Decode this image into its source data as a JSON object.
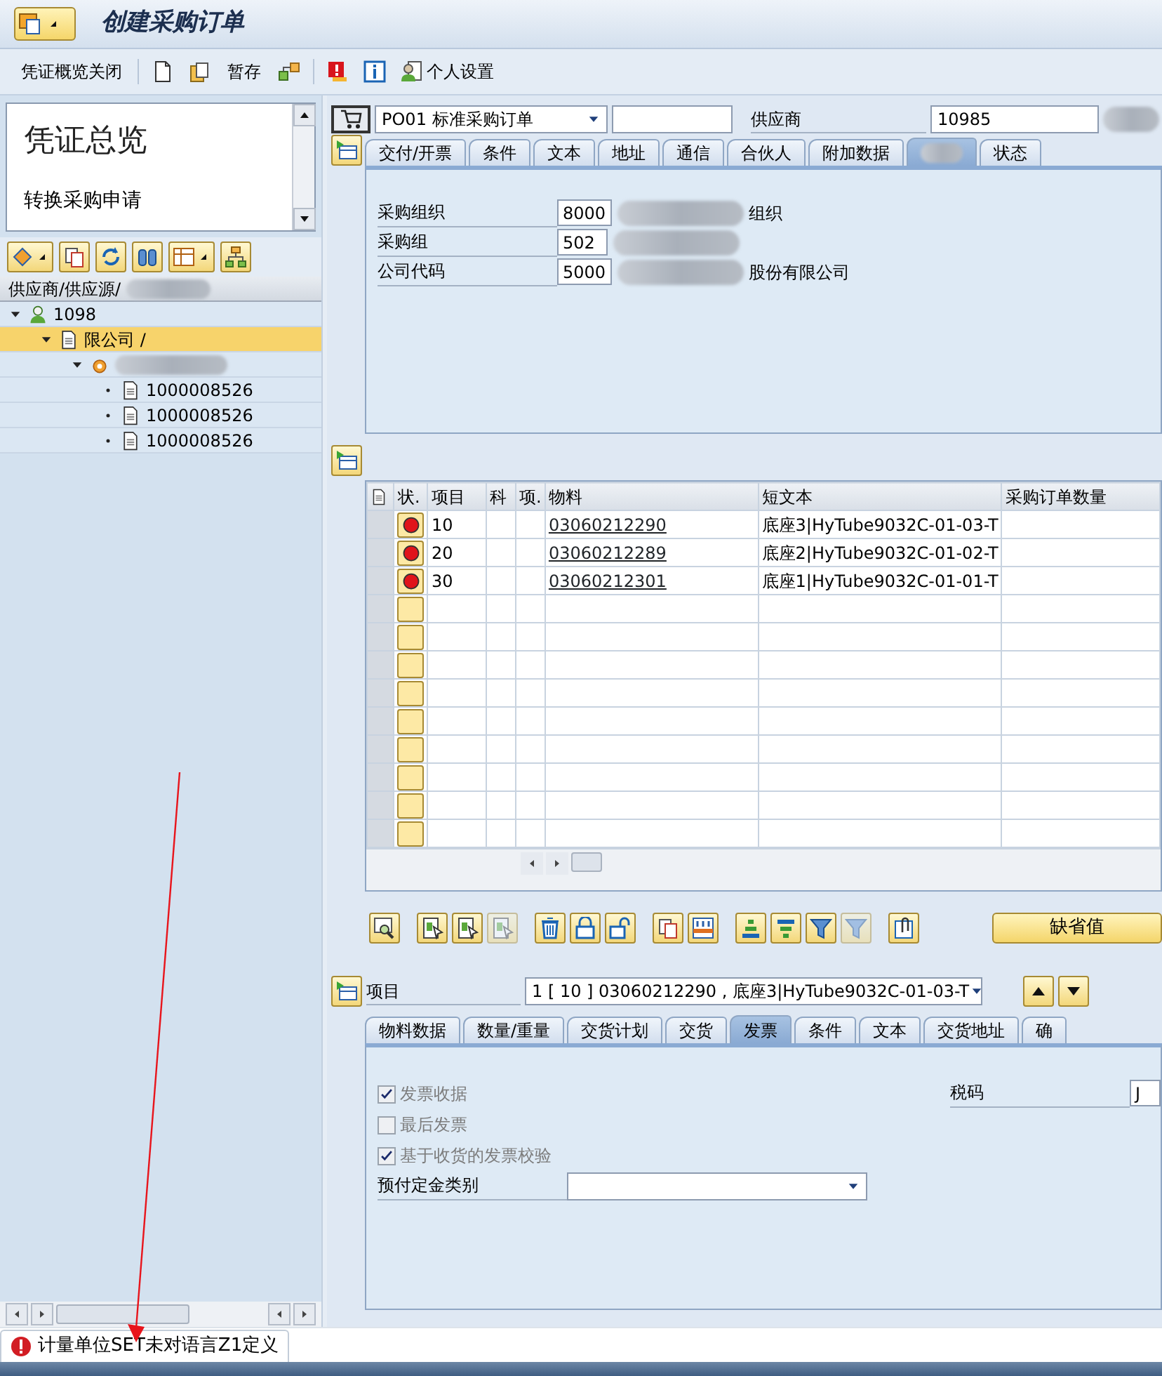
{
  "window": {
    "title": "创建采购订单"
  },
  "toolbar": [
    {
      "kind": "text",
      "label": "凭证概览关闭"
    },
    {
      "kind": "page"
    },
    {
      "kind": "clipboard"
    },
    {
      "kind": "text",
      "label": "暂存"
    },
    {
      "kind": "boxes"
    },
    {
      "kind": "alert"
    },
    {
      "kind": "info"
    },
    {
      "kind": "person",
      "label": "个人设置"
    }
  ],
  "overview": {
    "title": "凭证总览",
    "items": [
      "转换采购申请"
    ]
  },
  "tree_toolbar": [
    {
      "kind": "move",
      "menu": true
    },
    {
      "kind": "copy",
      "menu": false
    },
    {
      "kind": "refresh",
      "menu": false
    },
    {
      "kind": "find",
      "menu": false
    },
    {
      "kind": "layout",
      "menu": true
    },
    {
      "kind": "tree",
      "menu": false
    }
  ],
  "tree": {
    "header": "供应商/供应源/",
    "nodes": [
      {
        "kind": "vendor",
        "label": "1098",
        "expanded": true,
        "selected": false,
        "children": [
          {
            "kind": "doc",
            "label": "限公司 /",
            "expanded": true,
            "selected": true,
            "children": [
              {
                "kind": "group",
                "expanded": true,
                "selected": false,
                "children": [
                  {
                    "kind": "item",
                    "label": "1000008526",
                    "selected": false
                  },
                  {
                    "kind": "item",
                    "label": "1000008526",
                    "selected": false
                  },
                  {
                    "kind": "item",
                    "label": "1000008526",
                    "selected": false
                  }
                ]
              }
            ]
          }
        ]
      }
    ]
  },
  "header": {
    "doc_type": "PO01 标准采购订单",
    "vendor_label": "供应商",
    "vendor_value": "10985",
    "tabs": [
      {
        "label": "交付/开票",
        "selected": false
      },
      {
        "label": "条件",
        "selected": false
      },
      {
        "label": "文本",
        "selected": false
      },
      {
        "label": "地址",
        "selected": false
      },
      {
        "label": "通信",
        "selected": false
      },
      {
        "label": "合伙人",
        "selected": false
      },
      {
        "label": "附加数据",
        "selected": false
      },
      {
        "selected": true,
        "blurred": true
      },
      {
        "label": "状态",
        "selected": false
      }
    ],
    "fields": [
      {
        "label": "采购组织",
        "value": "8000",
        "description": "组织"
      },
      {
        "label": "采购组",
        "value": "502"
      },
      {
        "label": "公司代码",
        "value": "5000",
        "description": "股份有限公司"
      }
    ]
  },
  "items_table": {
    "columns": [
      "状.",
      "项目",
      "科",
      "项.",
      "物料",
      "短文本",
      "采购订单数量"
    ],
    "rows": [
      {
        "kind": "filled",
        "error": true,
        "item": "10",
        "material": "03060212290",
        "short_text": "底座3|HyTube9032C-01-03-T"
      },
      {
        "kind": "filled",
        "error": true,
        "item": "20",
        "material": "03060212289",
        "short_text": "底座2|HyTube9032C-01-02-T"
      },
      {
        "kind": "filled",
        "error": true,
        "item": "30",
        "material": "03060212301",
        "short_text": "底座1|HyTube9032C-01-01-T"
      },
      {
        "kind": "empty"
      },
      {
        "kind": "empty"
      },
      {
        "kind": "empty"
      },
      {
        "kind": "empty"
      },
      {
        "kind": "empty"
      },
      {
        "kind": "empty"
      },
      {
        "kind": "empty"
      },
      {
        "kind": "empty"
      },
      {
        "kind": "empty"
      }
    ]
  },
  "table_toolbar": [
    {
      "kind": "details",
      "disabled": false
    },
    {
      "kind": "docarrow",
      "disabled": false
    },
    {
      "kind": "docarrow",
      "disabled": false
    },
    {
      "kind": "docarrow",
      "disabled": true
    },
    {
      "kind": "trash",
      "disabled": false
    },
    {
      "kind": "lock",
      "disabled": false
    },
    {
      "kind": "unlock",
      "disabled": false
    },
    {
      "kind": "copy",
      "disabled": false
    },
    {
      "kind": "grid",
      "disabled": false
    },
    {
      "kind": "sortup",
      "disabled": false
    },
    {
      "kind": "sortdown",
      "disabled": false
    },
    {
      "kind": "filter",
      "disabled": false
    },
    {
      "kind": "filter",
      "disabled": true
    },
    {
      "kind": "clip",
      "disabled": false
    }
  ],
  "default_button": "缺省值",
  "item_detail": {
    "label": "项目",
    "value": "1 [ 10 ] 03060212290 , 底座3|HyTube9032C-01-03-T",
    "tabs": [
      {
        "label": "物料数据",
        "selected": false
      },
      {
        "label": "数量/重量",
        "selected": false
      },
      {
        "label": "交货计划",
        "selected": false
      },
      {
        "label": "交货",
        "selected": false
      },
      {
        "label": "发票",
        "selected": true
      },
      {
        "label": "条件",
        "selected": false
      },
      {
        "label": "文本",
        "selected": false
      },
      {
        "label": "交货地址",
        "selected": false
      },
      {
        "label": "确",
        "selected": false
      }
    ],
    "checkboxes": [
      {
        "label": "发票收据",
        "checked": true,
        "disabled": true
      },
      {
        "label": "最后发票",
        "checked": false,
        "disabled": true
      },
      {
        "label": "基于收货的发票校验",
        "checked": true,
        "disabled": true
      }
    ],
    "prepayment_label": "预付定金类别",
    "tax_label": "税码",
    "tax_value": "J"
  },
  "status_bar": {
    "error": true,
    "message": "计量单位SET未对语言Z1定义"
  },
  "annotation_arrow": true
}
